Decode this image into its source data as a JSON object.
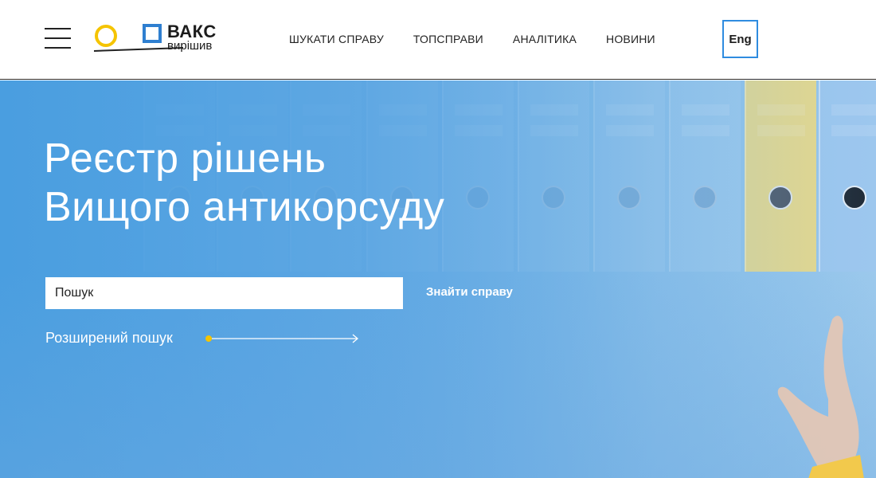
{
  "header": {
    "logo": {
      "title": "ВАКС",
      "subtitle": "вирішив"
    },
    "nav": [
      {
        "label": "ШУКАТИ СПРАВУ"
      },
      {
        "label": "ТОПСПРАВИ"
      },
      {
        "label": "АНАЛІТИКА"
      },
      {
        "label": "НОВИНИ"
      }
    ],
    "language_button": "Eng"
  },
  "hero": {
    "title_line1": "Реєстр рішень",
    "title_line2": "Вищого антикорсуду",
    "search": {
      "placeholder": "Пошук",
      "button_label": "Знайти справу"
    },
    "advanced_search_label": "Розширений пошук"
  },
  "colors": {
    "accent_blue": "#2f8ce0",
    "logo_yellow": "#f5c400",
    "hero_blue": "#4a9ee0"
  },
  "icons": [
    "menu-icon",
    "arrow-right-icon"
  ]
}
